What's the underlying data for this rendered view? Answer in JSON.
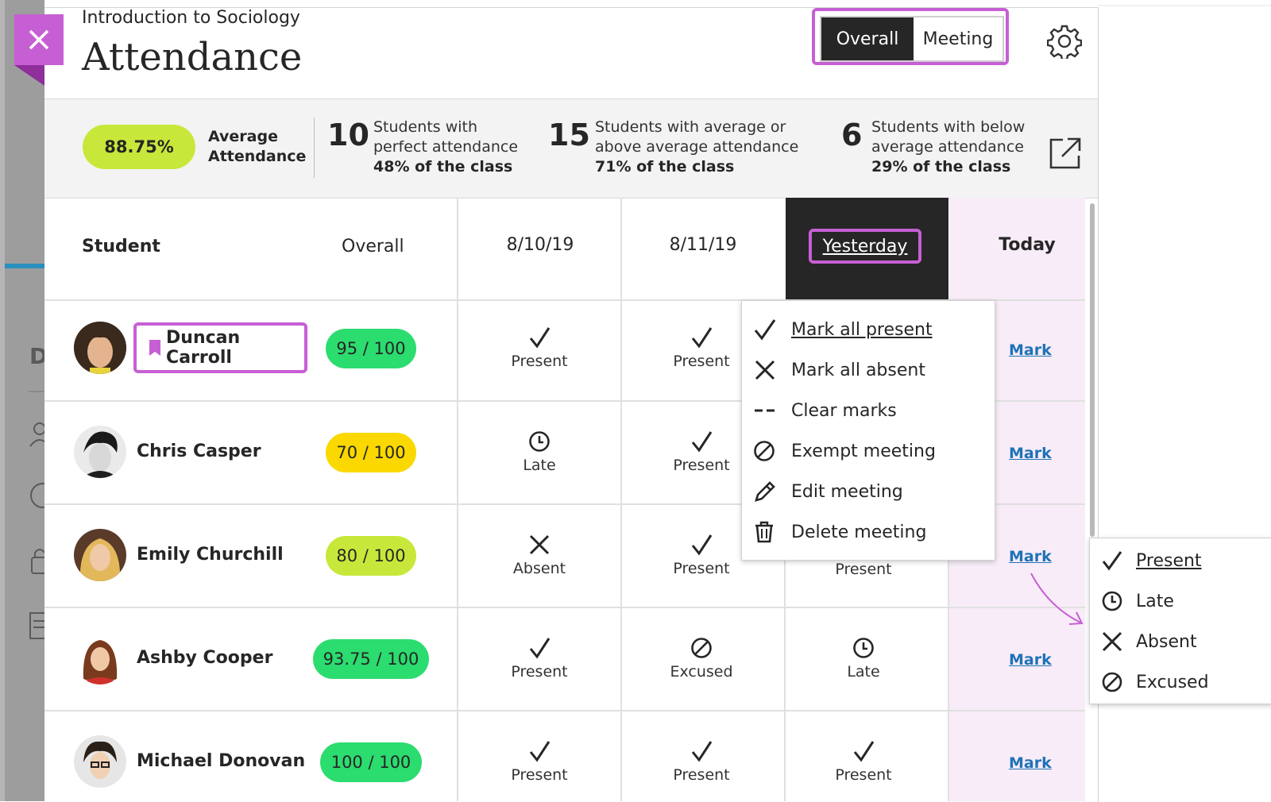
{
  "header": {
    "course": "Introduction to Sociology",
    "title": "Attendance",
    "view_toggle": {
      "active": "Overall",
      "inactive": "Meeting"
    }
  },
  "background_page": {
    "partial_letter": "D"
  },
  "stats": {
    "average_value": "88.75%",
    "average_label": "Average Attendance",
    "perfect": {
      "count": "10",
      "label": "Students with perfect attendance",
      "pct": "48% of the class"
    },
    "above": {
      "count": "15",
      "label": "Students with average or above average attendance",
      "pct": "71% of the class"
    },
    "below": {
      "count": "6",
      "label": "Students with below average attendance",
      "pct": "29% of the class"
    }
  },
  "table": {
    "headers": {
      "student": "Student",
      "overall": "Overall",
      "col1": "8/10/19",
      "col2": "8/11/19",
      "col3": "Yesterday",
      "col4": "Today"
    },
    "mark_label": "Mark",
    "rows": [
      {
        "name": "Duncan Carroll",
        "score": "95 / 100",
        "score_color": "#2bdc6e",
        "c1": "Present",
        "c2": "Present",
        "c3": ""
      },
      {
        "name": "Chris Casper",
        "score": "70 / 100",
        "score_color": "#fad800",
        "c1": "Late",
        "c2": "Present",
        "c3": ""
      },
      {
        "name": "Emily Churchill",
        "score": "80 / 100",
        "score_color": "#c7e83a",
        "c1": "Absent",
        "c2": "Present",
        "c3": "Present"
      },
      {
        "name": "Ashby Cooper",
        "score": "93.75 / 100",
        "score_color": "#2bdc6e",
        "c1": "Present",
        "c2": "Excused",
        "c3": "Late"
      },
      {
        "name": "Michael Donovan",
        "score": "100 / 100",
        "score_color": "#2bdc6e",
        "c1": "Present",
        "c2": "Present",
        "c3": "Present"
      }
    ]
  },
  "meeting_menu": {
    "items": [
      "Mark all present",
      "Mark all absent",
      "Clear marks",
      "Exempt meeting",
      "Edit meeting",
      "Delete meeting"
    ]
  },
  "mark_menu": {
    "items": [
      "Present",
      "Late",
      "Absent",
      "Excused"
    ]
  },
  "colors": {
    "accent": "#c75fd4",
    "link": "#1f73b7",
    "today_bg": "#f8ecf8"
  }
}
